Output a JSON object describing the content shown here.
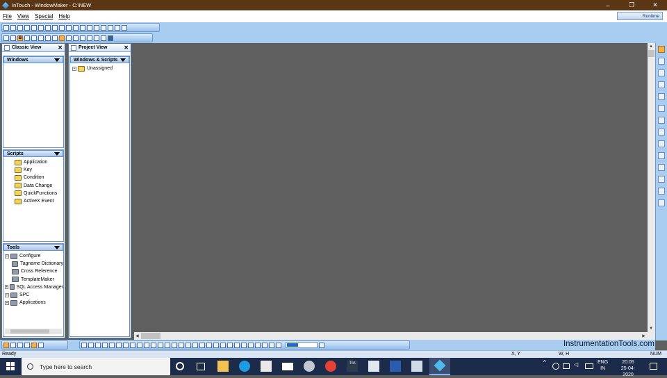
{
  "window": {
    "title": "InTouch - WindowMaker - C:\\NEW"
  },
  "menu": [
    "File",
    "View",
    "Special",
    "Help"
  ],
  "runtime_button": "Runtime",
  "classic_view": {
    "title": "Classic View",
    "close": "✕",
    "windows": {
      "title": "Windows"
    },
    "scripts": {
      "title": "Scripts",
      "items": [
        "Application",
        "Key",
        "Condition",
        "Data Change",
        "QuickFunctions",
        "ActiveX Event"
      ]
    },
    "tools": {
      "title": "Tools",
      "items": [
        {
          "label": "Configure",
          "expandable": true
        },
        {
          "label": "Tagname Dictionary",
          "expandable": false
        },
        {
          "label": "Cross Reference",
          "expandable": false
        },
        {
          "label": "TemplateMaker",
          "expandable": false
        },
        {
          "label": "SQL Access Manager",
          "expandable": true
        },
        {
          "label": "SPC",
          "expandable": true
        },
        {
          "label": "Applications",
          "expandable": true
        }
      ]
    }
  },
  "project_view": {
    "title": "Project View",
    "close": "✕",
    "section": "Windows & Scripts",
    "items": [
      "Unassigned"
    ]
  },
  "watermark": "InstrumentationTools.com",
  "status": {
    "ready": "Ready",
    "xy": "X, Y",
    "wh": "W, H",
    "num": "NUM"
  },
  "taskbar": {
    "search_placeholder": "Type here to search",
    "lang": "ENG",
    "region": "IN",
    "time": "20:05",
    "date": "25-04-2020"
  },
  "colors": {
    "titlebar": "#5a3614",
    "toolbar": "#a9cdf0",
    "canvas": "#5f5f5f",
    "taskbar": "#1c2b4a"
  }
}
